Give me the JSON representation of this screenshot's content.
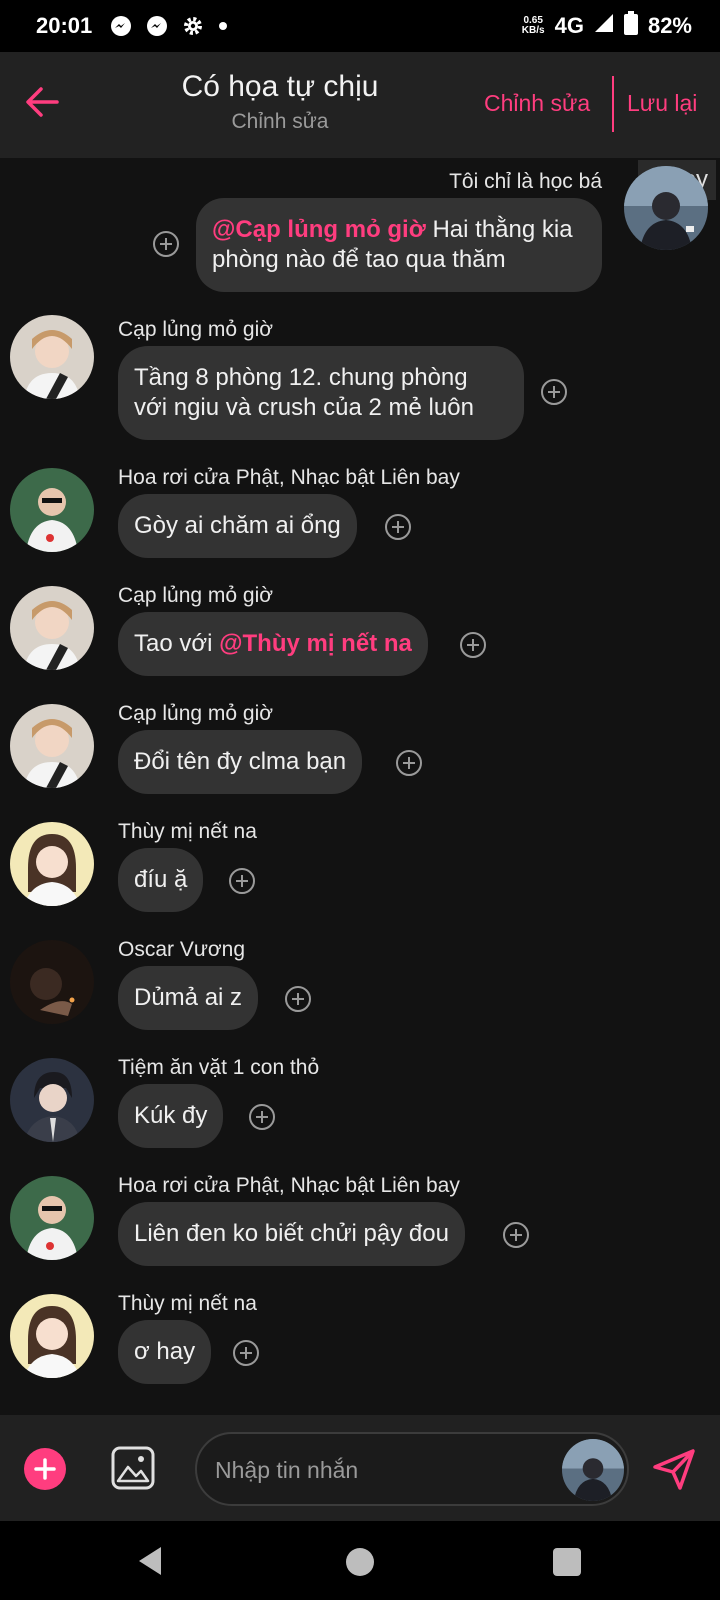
{
  "status_bar": {
    "time": "20:01",
    "net_speed_value": "0.65",
    "net_speed_unit": "KB/s",
    "network": "4G",
    "battery": "82%",
    "notification_icons": [
      "messenger-icon",
      "messenger-icon",
      "gear-icon",
      "dot-icon"
    ]
  },
  "header": {
    "title": "Có họa tự chịu",
    "subtitle": "Chỉnh sửa",
    "edit_label": "Chỉnh sửa",
    "save_label": "Lưu lại"
  },
  "messages": [
    {
      "sender": "Tôi chỉ là học bá",
      "mention": "@Cạp lủng mỏ giờ",
      "line1": " Hai thằng kia",
      "line2": "phòng nào để tao qua thăm",
      "own": true,
      "badge": "22 joy"
    },
    {
      "sender": "Cạp lủng mỏ giờ",
      "line1": "Tầng 8 phòng 12. chung phòng",
      "line2": "với ngiu và crush của 2 mẻ luôn"
    },
    {
      "sender": "Hoa rơi cửa Phật, Nhạc bật Liên bay",
      "text": "Gòy ai chăm ai ổng"
    },
    {
      "sender": "Cạp lủng mỏ giờ",
      "text": "Tao với ",
      "mention": "@Thùy mị nết na"
    },
    {
      "sender": "Cạp lủng mỏ giờ",
      "text": "Đổi tên đy clma bạn"
    },
    {
      "sender": "Thùy mị nết na",
      "text": "đíu ặ"
    },
    {
      "sender": "Oscar Vương",
      "text": "Dủmả ai z"
    },
    {
      "sender": "Tiệm ăn vặt 1 con thỏ",
      "text": "Kúk đy"
    },
    {
      "sender": "Hoa rơi cửa Phật, Nhạc bật Liên bay",
      "text": "Liên đen ko biết chửi pậy đou"
    },
    {
      "sender": "Thùy mị nết na",
      "text": "ơ hay"
    }
  ],
  "input": {
    "placeholder": "Nhập tin nhắn"
  },
  "colors": {
    "accent": "#ff3d7f",
    "background": "#121212",
    "bubble": "#333333",
    "header": "#222222"
  }
}
